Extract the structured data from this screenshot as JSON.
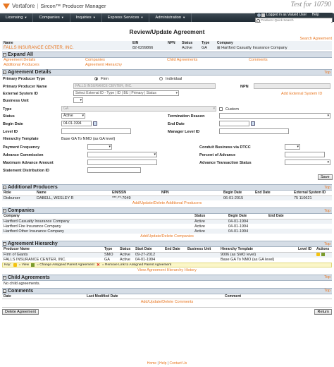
{
  "header": {
    "company": "Vertafore",
    "app_name": "Sircon",
    "app_suffix": "Producer Manager",
    "trademark": "™",
    "test_banner": "Test for 10790",
    "user_text": "Logged in as Valued User",
    "help_label": "Help",
    "search_placeholder": "Producer Quick Search"
  },
  "nav": [
    {
      "label": "Licensing"
    },
    {
      "label": "Companies"
    },
    {
      "label": "Inquiries"
    },
    {
      "label": "Express Services"
    },
    {
      "label": "Administration"
    }
  ],
  "page": {
    "title": "Review/Update Agreement",
    "search_agreement": "Search Agreement"
  },
  "summary": {
    "headers": [
      "Name",
      "EIN",
      "NPN",
      "Status",
      "Type",
      "Company"
    ],
    "name": "FALLS INSURANCE CENTER, INC.",
    "ein": "82-0299866",
    "npn": "",
    "status": "Active",
    "type": "GA",
    "company": "Hartford Casualty Insurance Company"
  },
  "expand_all": {
    "title": "Expand All",
    "links": [
      "Agreement Details",
      "Companies",
      "Child Agreements",
      "Comments",
      "Additional Producers",
      "Agreement Hierarchy"
    ]
  },
  "details": {
    "title": "Agreement Details",
    "top": "Top",
    "primary_producer_type_label": "Primary Producer Type",
    "firm_label": "Firm",
    "individual_label": "Individual",
    "primary_producer_name_label": "Primary Producer Name",
    "primary_producer_name_value": "FALLS INSURANCE CENTER, INC.",
    "npn_label": "NPN",
    "external_system_id_label": "External System ID",
    "external_system_id_value": "Select External ID - Type | ID | BU | Primary | Status",
    "add_external_id": "Add External System ID",
    "business_unit_label": "Business Unit",
    "type_label": "Type",
    "type_value": "GA",
    "custom_label": "Custom",
    "status_label": "Status",
    "status_value": "Active",
    "termination_reason_label": "Termination Reason",
    "begin_date_label": "Begin Date",
    "begin_date_value": "04-01-1994",
    "end_date_label": "End Date",
    "level_id_label": "Level ID",
    "manager_level_id_label": "Manager Level ID",
    "hierarchy_template_label": "Hierarchy Template",
    "hierarchy_template_value": "Base GA To NMO (as GA level)",
    "payment_frequency_label": "Payment Frequency",
    "conduit_label": "Conduit Business via DTCC",
    "advance_commission_label": "Advance Commission",
    "percent_advance_label": "Percent of Advance",
    "max_advance_label": "Maximum Advance Amount",
    "advance_tx_status_label": "Advance Transaction Status",
    "statement_dist_label": "Statement Distribution ID",
    "save_label": "Save"
  },
  "additional_producers": {
    "title": "Additional Producers",
    "top": "Top",
    "headers": [
      "Role",
      "Name",
      "EIN/SSN",
      "NPN",
      "Begin Date",
      "End Date",
      "External System ID"
    ],
    "rows": [
      [
        "Disburser",
        "DABELL, WESLEY R",
        "***-**-7049",
        "",
        "06-01-2015",
        "",
        "75 110621"
      ]
    ],
    "link": "Add/Update/Delete Additional Producers"
  },
  "companies": {
    "title": "Companies",
    "top": "Top",
    "headers": [
      "Company",
      "Status",
      "Begin Date",
      "End Date"
    ],
    "rows": [
      [
        "Hartford Casualty Insurance Company",
        "Active",
        "04-01-1994",
        ""
      ],
      [
        "Hartford Fire Insurance Company",
        "Active",
        "04-01-1994",
        ""
      ],
      [
        "Hartford Other Insurance Company",
        "Active",
        "04-01-1994",
        ""
      ]
    ],
    "link": "Add/Update/Delete Companies"
  },
  "hierarchy": {
    "title": "Agreement Hierarchy",
    "top": "Top",
    "headers": [
      "Producer Name",
      "Type",
      "Status",
      "Start Date",
      "End Date",
      "Business Unit",
      "Hierarchy Template",
      "Level ID",
      "Actions"
    ],
    "rows": [
      [
        "Firm of Giants",
        "SMO",
        "Active",
        "09-27-2012",
        "",
        "",
        "9006 (as SMO level)",
        ""
      ],
      [
        "FALLS INSURANCE CENTER, INC.",
        "GA",
        "Active",
        "04-01-1994",
        "",
        "",
        "Base GA To NMO (as GA level)",
        ""
      ]
    ],
    "key_label": "Key:",
    "key_view": "= View",
    "key_change": "= Change Assigned Parent Agreement",
    "key_remove": "= Remove Link to Assigned Parent Agreement",
    "link": "View Agreement Hierarchy History"
  },
  "child_agreements": {
    "title": "Child Agreements",
    "top": "Top",
    "empty": "No child agreements."
  },
  "comments": {
    "title": "Comments",
    "top": "Top",
    "headers": [
      "Date",
      "Last Modified Date",
      "Comment"
    ],
    "link": "Add/Update/Delete Comments"
  },
  "actions": {
    "delete": "Delete Agreement",
    "return": "Return"
  },
  "footer": {
    "home": "Home",
    "help": "Help",
    "contact": "Contact Us"
  }
}
